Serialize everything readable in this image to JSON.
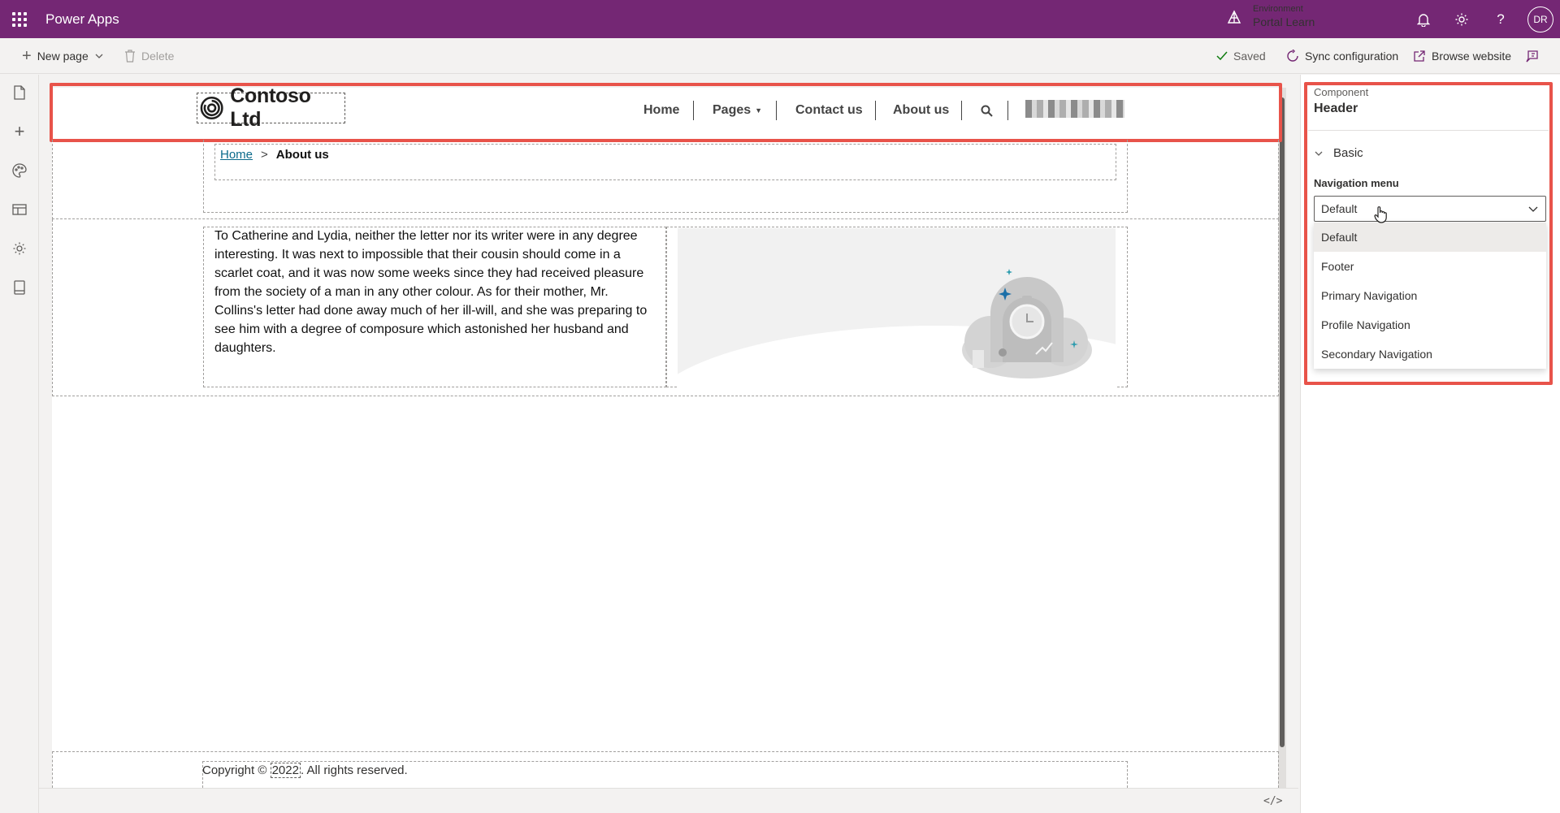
{
  "app": {
    "title": "Power Apps",
    "environment_label": "Environment",
    "environment_name": "Portal Learn",
    "user_initials": "DR",
    "brand_color": "#742774"
  },
  "commandbar": {
    "new_page": "New page",
    "delete": "Delete",
    "saved": "Saved",
    "sync": "Sync configuration",
    "browse": "Browse website"
  },
  "leftrail": {
    "items": [
      "pages-icon",
      "add-icon",
      "styling-icon",
      "data-icon",
      "settings-icon",
      "templates-icon"
    ]
  },
  "site": {
    "logo_text": "Contoso Ltd",
    "nav": [
      "Home",
      "Pages",
      "Contact us",
      "About us"
    ],
    "breadcrumb_home": "Home",
    "breadcrumb_sep": ">",
    "breadcrumb_current": "About us",
    "body_text": "To Catherine and Lydia, neither the letter nor its writer were in any degree interesting. It was next to impossible that their cousin should come in a scarlet coat, and it was now some weeks since they had received pleasure from the society of a man in any other colour. As for their mother, Mr. Collins's letter had done away much of her ill-will, and she was preparing to see him with a degree of composure which astonished her husband and daughters.",
    "footer_prefix": "Copyright © ",
    "footer_year": "2022",
    "footer_suffix": ". All rights reserved."
  },
  "panel": {
    "component_label": "Component",
    "component_name": "Header",
    "section": "Basic",
    "field_label": "Navigation menu",
    "selected": "Default",
    "options": [
      "Default",
      "Footer",
      "Primary Navigation",
      "Profile Navigation",
      "Secondary Navigation"
    ]
  },
  "canvas": {
    "code_toggle": "</>"
  },
  "colors": {
    "highlight": "#e8534a",
    "link": "#0b6a8b"
  }
}
